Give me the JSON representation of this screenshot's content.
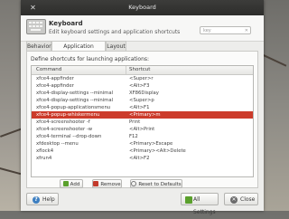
{
  "window": {
    "title": "Keyboard"
  },
  "header": {
    "title": "Keyboard",
    "subtitle": "Edit keyboard settings and application shortcuts",
    "search_placeholder": "key"
  },
  "tabs": [
    {
      "label": "Behavior",
      "active": false
    },
    {
      "label": "Application Shortcuts",
      "active": true
    },
    {
      "label": "Layout",
      "active": false
    }
  ],
  "panel": {
    "description": "Define shortcuts for launching applications:",
    "columns": {
      "command": "Command",
      "shortcut": "Shortcut"
    },
    "rows": [
      {
        "command": "xfce4-appfinder",
        "shortcut": "<Super>r",
        "selected": false
      },
      {
        "command": "xfce4-appfinder",
        "shortcut": "<Alt>F3",
        "selected": false
      },
      {
        "command": "xfce4-display-settings --minimal",
        "shortcut": "XF86Display",
        "selected": false
      },
      {
        "command": "xfce4-display-settings --minimal",
        "shortcut": "<Super>p",
        "selected": false
      },
      {
        "command": "xfce4-popup-applicationsmenu",
        "shortcut": "<Alt>F1",
        "selected": false
      },
      {
        "command": "xfce4-popup-whiskermenu",
        "shortcut": "<Primary>m",
        "selected": true
      },
      {
        "command": "xfce4-screenshooter -f",
        "shortcut": "Print",
        "selected": false
      },
      {
        "command": "xfce4-screenshooter -w",
        "shortcut": "<Alt>Print",
        "selected": false
      },
      {
        "command": "xfce4-terminal --drop-down",
        "shortcut": "F12",
        "selected": false
      },
      {
        "command": "xfdesktop --menu",
        "shortcut": "<Primary>Escape",
        "selected": false
      },
      {
        "command": "xflock4",
        "shortcut": "<Primary><Alt>Delete",
        "selected": false
      },
      {
        "command": "xfrun4",
        "shortcut": "<Alt>F2",
        "selected": false
      }
    ],
    "buttons": {
      "add": "Add",
      "remove": "Remove",
      "reset": "Reset to Defaults"
    }
  },
  "footer": {
    "help": "Help",
    "all_settings": "All Settings",
    "close": "Close"
  },
  "colors": {
    "selection": "#cc3b2b",
    "titlebar": "#2d2d2b"
  }
}
